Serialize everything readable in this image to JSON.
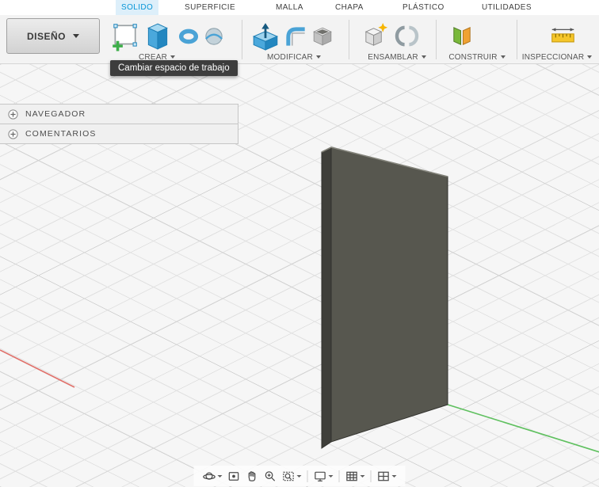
{
  "tabs": {
    "items": [
      {
        "label": "SOLIDO",
        "active": true
      },
      {
        "label": "SUPERFICIE",
        "active": false
      },
      {
        "label": "MALLA",
        "active": false
      },
      {
        "label": "CHAPA",
        "active": false
      },
      {
        "label": "PLÁSTICO",
        "active": false
      },
      {
        "label": "UTILIDADES",
        "active": false
      }
    ]
  },
  "toolbar": {
    "workspace_button_label": "DISEÑO",
    "groups": [
      {
        "label": "CREAR"
      },
      {
        "label": "MODIFICAR"
      },
      {
        "label": "ENSAMBLAR"
      },
      {
        "label": "CONSTRUIR"
      },
      {
        "label": "INSPECCIONAR"
      }
    ],
    "icons": [
      "create-sketch",
      "extrude",
      "revolve",
      "sweep",
      "press-pull",
      "fillet",
      "shell",
      "new-component",
      "joint",
      "construct-plane",
      "measure"
    ]
  },
  "tooltip": {
    "text": "Cambiar espacio de trabajo"
  },
  "browser_panels": [
    {
      "label": "NAVEGADOR"
    },
    {
      "label": "COMENTARIOS"
    }
  ],
  "viewport": {
    "grid_visible": true,
    "axis_x_color": "#e0706a",
    "axis_y_color": "#5fc05f",
    "model": {
      "shape": "thin vertical rectangular plate",
      "face_color": "#57574f",
      "side_color": "#3f3f3a",
      "edge_color": "#32322e"
    }
  },
  "nav_bar": {
    "buttons": [
      "orbit",
      "look-at",
      "pan",
      "zoom",
      "fit",
      "display-settings",
      "grid-display",
      "viewports"
    ]
  },
  "colors": {
    "accent_blue": "#0696d7",
    "active_tab_bg": "#ddeffa",
    "tooltip_bg": "#3d3d3d",
    "toolbar_bg": "#f3f3f3"
  }
}
